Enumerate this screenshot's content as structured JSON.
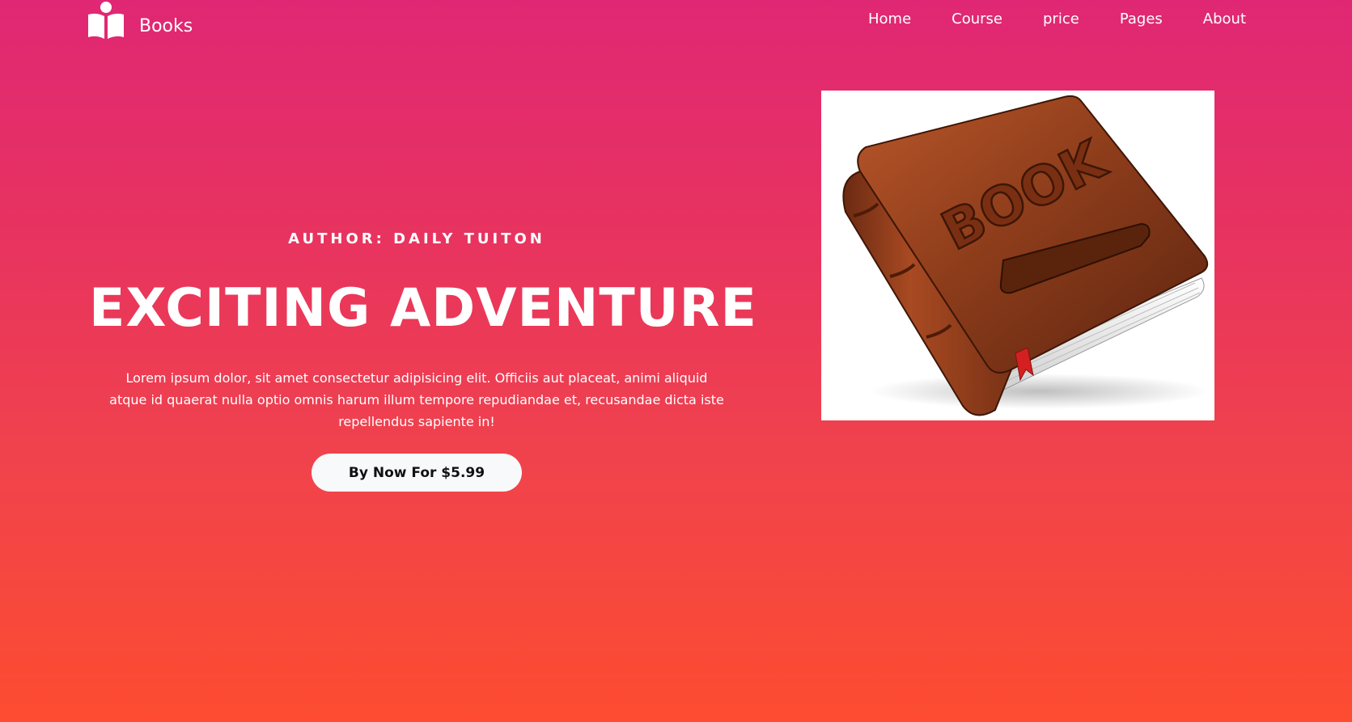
{
  "navbar": {
    "brand": {
      "icon": "open-book-reader-icon",
      "name": "Books"
    },
    "links": [
      {
        "label": "Home"
      },
      {
        "label": "Course"
      },
      {
        "label": "price"
      },
      {
        "label": "Pages"
      },
      {
        "label": "About"
      }
    ]
  },
  "hero": {
    "author": "AUTHOR: DAILY TUITON",
    "title": "EXCITING ADVENTURE",
    "description": "Lorem ipsum dolor, sit amet consectetur adipisicing elit. Officiis aut placeat, animi aliquid atque id quaerat nulla optio omnis harum illum tempore repudiandae et, recusandae dicta iste repellendus sapiente in!",
    "buy_button": "By Now For $5.99"
  },
  "book_image": {
    "cover_text": "BOOK"
  },
  "colors": {
    "gradient_top": "#e02774",
    "gradient_bottom": "#fd4c30",
    "button_bg": "#f8f9fa",
    "book_leather": "#8a3a1a"
  }
}
